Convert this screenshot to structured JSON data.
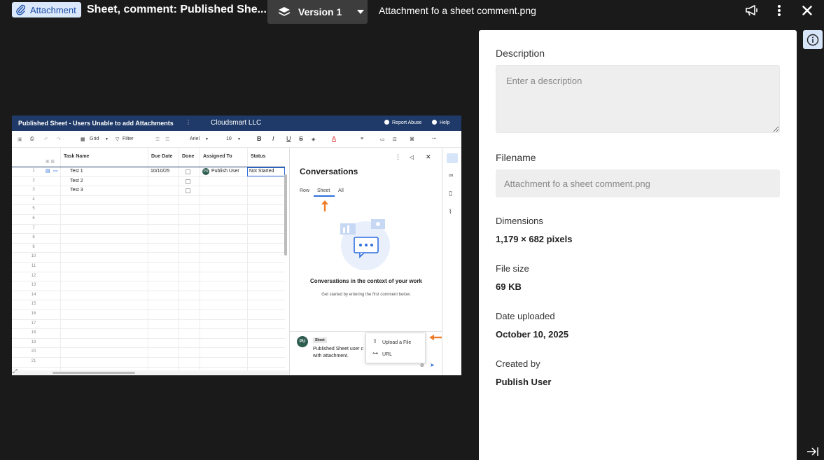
{
  "topbar": {
    "attachment_chip": "Attachment",
    "title": "Sheet, comment: Published She...",
    "version_label": "Version 1",
    "file_name": "Attachment fo a sheet comment.png"
  },
  "preview": {
    "sheet_title": "Published Sheet - Users Unable to add Attachments",
    "org_name": "Cloudsmart LLC",
    "report_abuse": "Report Abuse",
    "help": "Help",
    "toolbar": {
      "grid": "Grid",
      "filter": "Filter",
      "font": "Ariel",
      "size": "10",
      "bold": "B",
      "italic": "I",
      "underline": "U",
      "strike": "S",
      "more": "···"
    },
    "columns": [
      "Task Name",
      "Due Date",
      "Done",
      "Assigned To",
      "Status"
    ],
    "rows": [
      {
        "num": "1",
        "task": "Test 1",
        "due": "10/10/25",
        "assigned": "Publish User",
        "status": "Not Started",
        "avatar": "PU"
      },
      {
        "num": "2",
        "task": "Test 2",
        "due": "",
        "assigned": "",
        "status": ""
      },
      {
        "num": "3",
        "task": "Test 3",
        "due": "",
        "assigned": "",
        "status": ""
      }
    ],
    "empty_row_numbers": [
      "4",
      "5",
      "6",
      "7",
      "8",
      "9",
      "10",
      "11",
      "12",
      "13",
      "14",
      "15",
      "16",
      "17",
      "18",
      "19",
      "20",
      "21"
    ],
    "conversations": {
      "title": "Conversations",
      "tabs": [
        "Row",
        "Sheet",
        "All"
      ],
      "heading": "Conversations in the context of your work",
      "subtext": "Get started by entering the first comment below.",
      "commenter_initials": "PU",
      "context_badge": "Sheet",
      "comment_text_line1": "Published Sheet user c",
      "comment_text_line2": "with attachment.",
      "upload_file": "Upload a File",
      "url": "URL"
    }
  },
  "panel": {
    "description_label": "Description",
    "description_placeholder": "Enter a description",
    "filename_label": "Filename",
    "filename_value": "Attachment fo a sheet comment.png",
    "dimensions_label": "Dimensions",
    "dimensions_value": "1,179 × 682 pixels",
    "filesize_label": "File size",
    "filesize_value": "69 KB",
    "date_label": "Date uploaded",
    "date_value": "October 10, 2025",
    "created_label": "Created by",
    "created_value": "Publish User"
  },
  "colors": {
    "background": "#1a1a1a",
    "chip_bg": "#dbe7fb",
    "chip_text": "#1d4fa6",
    "sheet_header": "#1f3a68",
    "accent_orange": "#f07c2a",
    "accent_blue": "#2f6fde"
  }
}
